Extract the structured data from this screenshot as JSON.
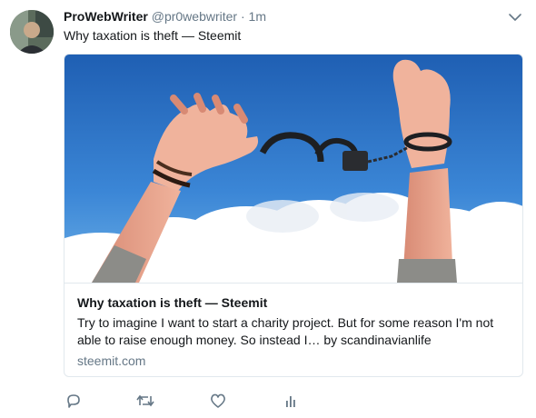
{
  "tweet": {
    "display_name": "ProWebWriter",
    "handle": "@pr0webwriter",
    "separator": "·",
    "time": "1m",
    "text": "Why taxation is theft — Steemit"
  },
  "card": {
    "title": "Why taxation is theft — Steemit",
    "description": "Try to imagine I want to start a charity project. But for some reason I'm not able to raise enough money. So instead I… by scandinavianlife",
    "domain": "steemit.com"
  },
  "icons": {
    "caret": "chevron-down-icon",
    "reply": "reply-icon",
    "retweet": "retweet-icon",
    "like": "heart-icon",
    "analytics": "analytics-icon"
  },
  "colors": {
    "secondary_text": "#657786",
    "border": "#e1e8ed",
    "sky": "#2f78c9"
  }
}
